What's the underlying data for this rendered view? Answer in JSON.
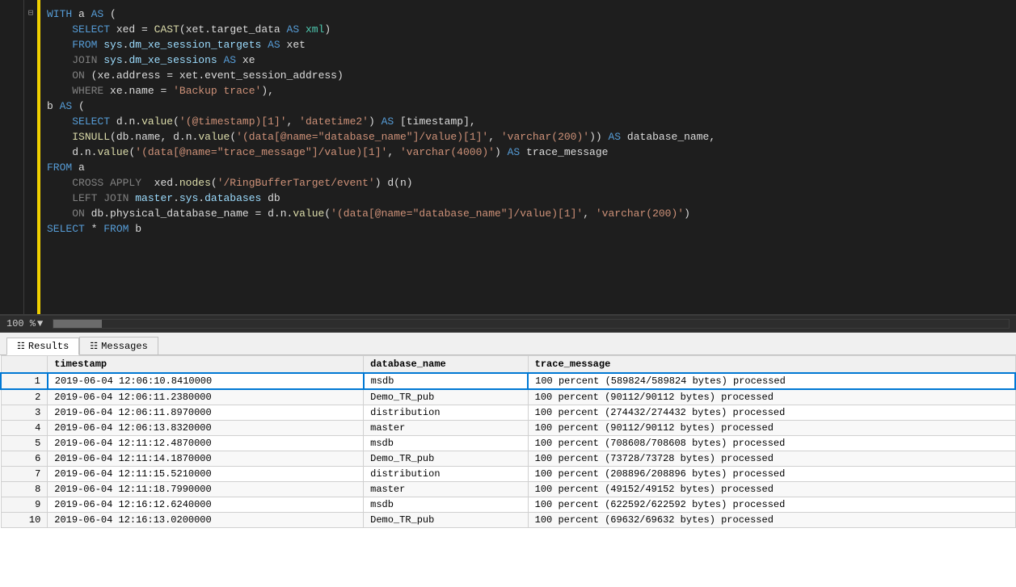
{
  "editor": {
    "zoom": "100 %",
    "lines": [
      {
        "num": "",
        "collapse": "⊟",
        "code": "WITH a AS ("
      },
      {
        "num": "",
        "collapse": "",
        "code": "    SELECT xed = CAST(xet.target_data AS xml)"
      },
      {
        "num": "",
        "collapse": "",
        "code": "    FROM sys.dm_xe_session_targets AS xet"
      },
      {
        "num": "",
        "collapse": "",
        "code": "    JOIN sys.dm_xe_sessions AS xe"
      },
      {
        "num": "",
        "collapse": "",
        "code": "    ON (xe.address = xet.event_session_address)"
      },
      {
        "num": "",
        "collapse": "",
        "code": "    WHERE xe.name = 'Backup trace'),"
      },
      {
        "num": "",
        "collapse": "",
        "code": "b AS ("
      },
      {
        "num": "",
        "collapse": "",
        "code": "    SELECT d.n.value('(@timestamp)[1]', 'datetime2') AS [timestamp],"
      },
      {
        "num": "",
        "collapse": "",
        "code": "    ISNULL(db.name, d.n.value('(data[@name=\"database_name\"]/value)[1]', 'varchar(200)')) AS database_name,"
      },
      {
        "num": "",
        "collapse": "",
        "code": "    d.n.value('(data[@name=\"trace_message\"]/value)[1]', 'varchar(4000)') AS trace_message"
      },
      {
        "num": "",
        "collapse": "",
        "code": "FROM a"
      },
      {
        "num": "",
        "collapse": "",
        "code": "    CROSS APPLY  xed.nodes('/RingBufferTarget/event') d(n)"
      },
      {
        "num": "",
        "collapse": "",
        "code": "    LEFT JOIN master.sys.databases db"
      },
      {
        "num": "",
        "collapse": "",
        "code": "    ON db.physical_database_name = d.n.value('(data[@name=\"database_name\"]/value)[1]', 'varchar(200)')"
      },
      {
        "num": "",
        "collapse": "",
        "code": "SELECT * FROM b"
      }
    ]
  },
  "tabs": {
    "results_label": "Results",
    "messages_label": "Messages"
  },
  "table": {
    "columns": [
      "",
      "timestamp",
      "database_name",
      "trace_message"
    ],
    "rows": [
      [
        "1",
        "2019-06-04 12:06:10.8410000",
        "msdb",
        "100 percent (589824/589824 bytes) processed"
      ],
      [
        "2",
        "2019-06-04 12:06:11.2380000",
        "Demo_TR_pub",
        "100 percent (90112/90112 bytes) processed"
      ],
      [
        "3",
        "2019-06-04 12:06:11.8970000",
        "distribution",
        "100 percent (274432/274432 bytes) processed"
      ],
      [
        "4",
        "2019-06-04 12:06:13.8320000",
        "master",
        "100 percent (90112/90112 bytes) processed"
      ],
      [
        "5",
        "2019-06-04 12:11:12.4870000",
        "msdb",
        "100 percent (708608/708608 bytes) processed"
      ],
      [
        "6",
        "2019-06-04 12:11:14.1870000",
        "Demo_TR_pub",
        "100 percent (73728/73728 bytes) processed"
      ],
      [
        "7",
        "2019-06-04 12:11:15.5210000",
        "distribution",
        "100 percent (208896/208896 bytes) processed"
      ],
      [
        "8",
        "2019-06-04 12:11:18.7990000",
        "master",
        "100 percent (49152/49152 bytes) processed"
      ],
      [
        "9",
        "2019-06-04 12:16:12.6240000",
        "msdb",
        "100 percent (622592/622592 bytes) processed"
      ],
      [
        "10",
        "2019-06-04 12:16:13.0200000",
        "Demo_TR_pub",
        "100 percent (69632/69632 bytes) processed"
      ]
    ]
  }
}
